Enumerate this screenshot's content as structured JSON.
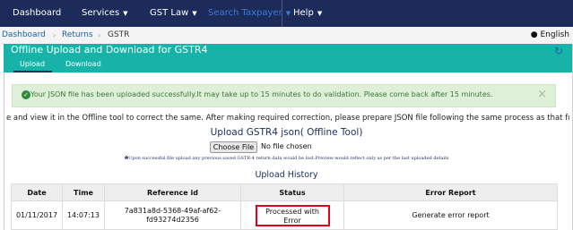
{
  "nav": {
    "items": [
      {
        "label": "Dashboard",
        "caret": ""
      },
      {
        "label": "Services",
        "caret": "▼"
      },
      {
        "label": "GST Law",
        "caret": "▼"
      },
      {
        "label": "Search Taxpayer",
        "caret": "▼"
      },
      {
        "label": "Help",
        "caret": "▼"
      }
    ]
  },
  "breadcrumb": {
    "items": [
      "Dashboard",
      "Returns",
      "GSTR"
    ],
    "separator": "›",
    "language": "English"
  },
  "panel": {
    "title": "Offline Upload and Download for GSTR4",
    "tabs": [
      "Upload",
      "Download"
    ],
    "refresh_icon": "↻"
  },
  "alert": {
    "text": "Your JSON file has been uploaded successfully.It may take up to 15 minutes to do validation. Please come back after 15 minutes.",
    "close": "×"
  },
  "instruction": "e and view it in the Offline tool to correct the same. After making required correction, please prepare JSON file following the same process as that for regular upload.",
  "upload": {
    "title": "Upload GSTR4 json( Offline Tool)",
    "choose_label": "Choose File",
    "no_file": "No file chosen",
    "note": "Upon successful file upload any previous saved GSTR-4 return data would be lost.Preview would reflect only as per the last uploaded details"
  },
  "history": {
    "title": "Upload History",
    "columns": [
      "Date",
      "Time",
      "Reference id",
      "Status",
      "Error Report"
    ],
    "rows": [
      {
        "date": "01/11/2017",
        "time": "14:07:13",
        "ref_line1": "7a831a8d-5368-49af-af62-",
        "ref_line2": "fd93274d2356",
        "status_line1": "Processed with",
        "status_line2": "Error",
        "error_report": "Generate error report"
      }
    ]
  },
  "colors": {
    "navbar": "#1c2b5a",
    "panel_header": "#17b3a9",
    "alert_bg": "#dff0d8",
    "alert_text": "#3c763d",
    "status_highlight": "#e0001b",
    "link": "#1a6fb5"
  }
}
